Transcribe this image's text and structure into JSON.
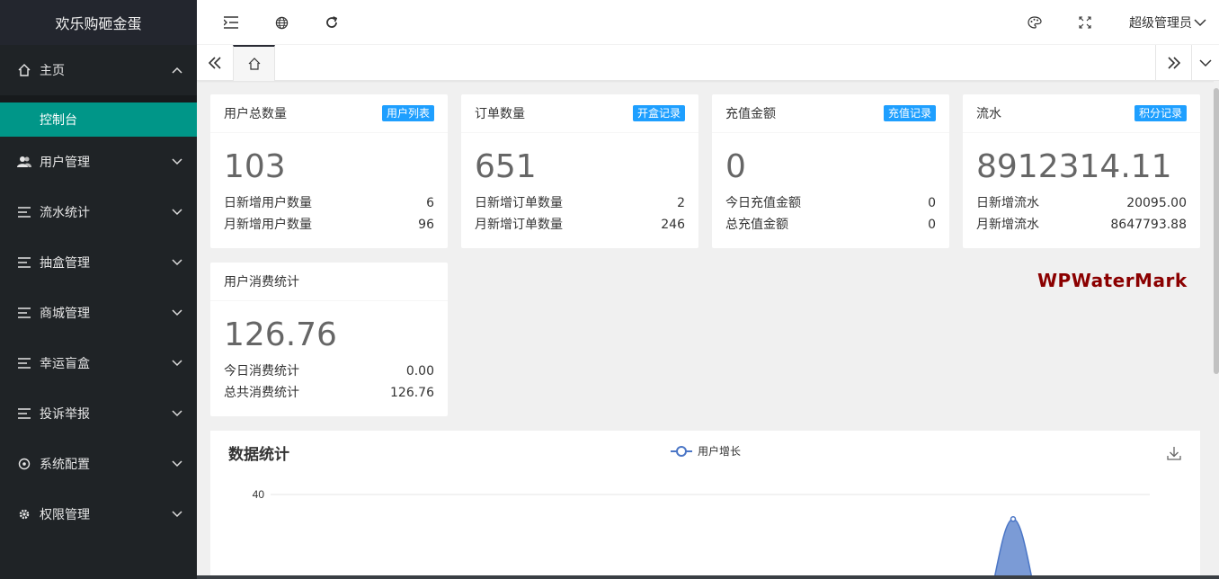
{
  "app": {
    "title": "欢乐购砸金蛋"
  },
  "sidebar": {
    "home": {
      "label": "主页",
      "icon": "home-icon",
      "children": [
        {
          "label": "控制台"
        }
      ]
    },
    "items": [
      {
        "label": "用户管理",
        "icon": "users-icon"
      },
      {
        "label": "流水统计",
        "icon": "list-icon"
      },
      {
        "label": "抽盒管理",
        "icon": "list-icon"
      },
      {
        "label": "商城管理",
        "icon": "list-icon"
      },
      {
        "label": "幸运盲盒",
        "icon": "list-icon"
      },
      {
        "label": "投诉举报",
        "icon": "list-icon"
      },
      {
        "label": "系统配置",
        "icon": "settings-circle-icon"
      },
      {
        "label": "权限管理",
        "icon": "gear-icon"
      }
    ]
  },
  "header": {
    "admin_label": "超级管理员"
  },
  "cards": [
    {
      "title": "用户总数量",
      "badge": "用户列表",
      "value": "103",
      "rows": [
        {
          "label": "日新增用户数量",
          "value": "6"
        },
        {
          "label": "月新增用户数量",
          "value": "96"
        }
      ]
    },
    {
      "title": "订单数量",
      "badge": "开盒记录",
      "value": "651",
      "rows": [
        {
          "label": "日新增订单数量",
          "value": "2"
        },
        {
          "label": "月新增订单数量",
          "value": "246"
        }
      ]
    },
    {
      "title": "充值金额",
      "badge": "充值记录",
      "value": "0",
      "rows": [
        {
          "label": "今日充值金额",
          "value": "0"
        },
        {
          "label": "总充值金额",
          "value": "0"
        }
      ]
    },
    {
      "title": "流水",
      "badge": "积分记录",
      "value": "8912314.11",
      "rows": [
        {
          "label": "日新增流水",
          "value": "20095.00"
        },
        {
          "label": "月新增流水",
          "value": "8647793.88"
        }
      ]
    },
    {
      "title": "用户消费统计",
      "badge": "",
      "value": "126.76",
      "rows": [
        {
          "label": "今日消费统计",
          "value": "0.00"
        },
        {
          "label": "总共消费统计",
          "value": "126.76"
        }
      ]
    }
  ],
  "watermark": "WPWaterMark",
  "chart_section": {
    "title": "数据统计",
    "legend": "用户增长"
  },
  "chart_data": {
    "type": "area",
    "series": [
      {
        "name": "用户增长",
        "peak": 35
      }
    ],
    "y_ticks": [
      "40"
    ],
    "color": "#4b76c6",
    "fill": "#7b9bd6"
  },
  "colors": {
    "accent": "#009688",
    "badge": "#1e9fff",
    "sidebar": "#1f2326"
  }
}
